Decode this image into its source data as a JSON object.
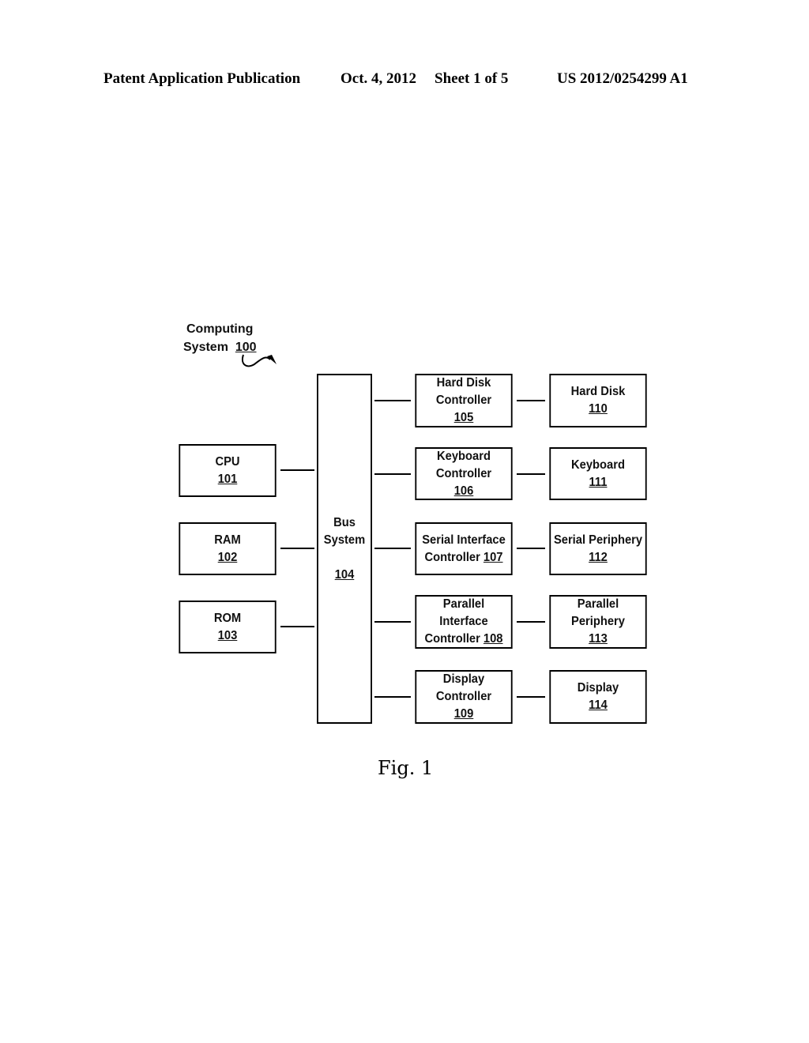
{
  "header": {
    "publication": "Patent Application Publication",
    "date": "Oct. 4, 2012",
    "sheet": "Sheet 1 of 5",
    "number": "US 2012/0254299 A1"
  },
  "diagram": {
    "system_label_line1": "Computing",
    "system_label_line2": "System",
    "system_ref": "100",
    "blocks": {
      "cpu": {
        "name": "CPU",
        "ref": "101"
      },
      "ram": {
        "name": "RAM",
        "ref": "102"
      },
      "rom": {
        "name": "ROM",
        "ref": "103"
      },
      "bus": {
        "line1": "Bus",
        "line2": "System",
        "ref": "104"
      },
      "hdc": {
        "line1": "Hard Disk",
        "line2": "Controller",
        "ref": "105"
      },
      "kbc": {
        "line1": "Keyboard",
        "line2": "Controller",
        "ref": "106"
      },
      "sic": {
        "line1": "Serial Interface",
        "line2": "Controller",
        "ref": "107"
      },
      "pic": {
        "line1": "Parallel",
        "line2": "Interface",
        "line3": "Controller",
        "ref": "108"
      },
      "dc": {
        "line1": "Display",
        "line2": "Controller",
        "ref": "109"
      },
      "hd": {
        "name": "Hard Disk",
        "ref": "110"
      },
      "kb": {
        "name": "Keyboard",
        "ref": "111"
      },
      "sp": {
        "name": "Serial Periphery",
        "ref": "112"
      },
      "pp": {
        "line1": "Parallel",
        "line2": "Periphery",
        "ref": "113"
      },
      "disp": {
        "name": "Display",
        "ref": "114"
      }
    }
  },
  "figure_caption": "Fig. 1"
}
